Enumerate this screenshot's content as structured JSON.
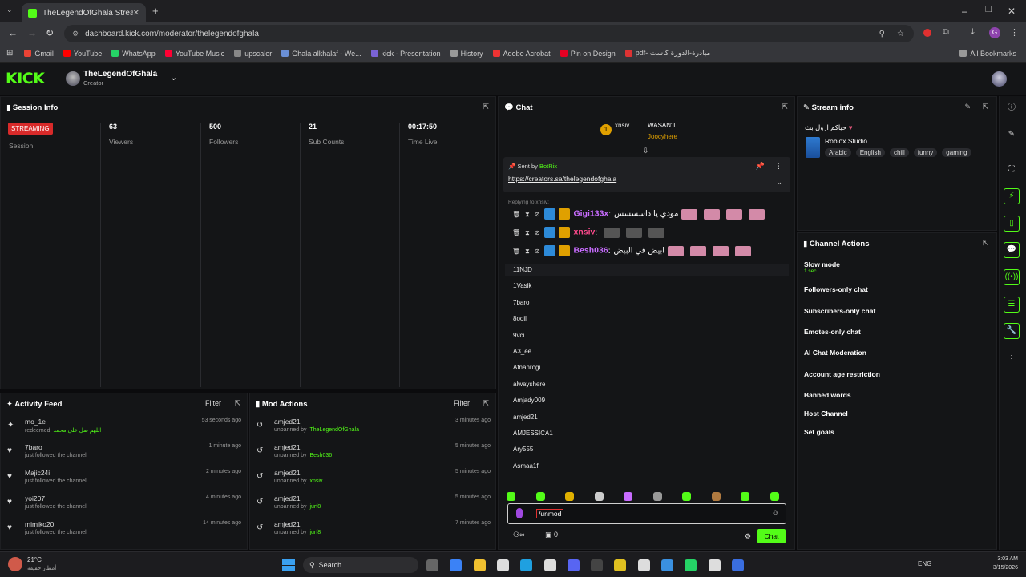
{
  "browser": {
    "tab_title": "TheLegendOfGhala Stream - Ki",
    "url": "dashboard.kick.com/moderator/thelegendofghala",
    "bookmarks": [
      "Gmail",
      "YouTube",
      "WhatsApp",
      "YouTube Music",
      "upscaler",
      "Ghala alkhalaf - We...",
      "kick - Presentation",
      "History",
      "Adobe Acrobat",
      "Pin on Design",
      "pdf- مبادرة-الدورة كاست",
      "All Bookmarks"
    ],
    "bookmark_colors": [
      "#ea4335",
      "#ff0000",
      "#25d366",
      "#ff0033",
      "#888888",
      "#6a8fd6",
      "#7a63d6",
      "#999999",
      "#e33",
      "#e60023",
      "#d33",
      "#999999"
    ]
  },
  "header": {
    "logo": "KICK",
    "channel": "TheLegendOfGhala",
    "role": "Creator"
  },
  "session": {
    "title": "Session Info",
    "status": "STREAMING",
    "status_label": "Session",
    "stats": [
      {
        "value": "63",
        "label": "Viewers"
      },
      {
        "value": "500",
        "label": "Followers"
      },
      {
        "value": "21",
        "label": "Sub Counts"
      },
      {
        "value": "00:17:50",
        "label": "Time Live"
      }
    ]
  },
  "activity": {
    "title": "Activity Feed",
    "filter": "Filter",
    "items": [
      {
        "icon": "✦",
        "name": "mo_1e",
        "sub": "redeemed",
        "sub2": "اللهم صل على محمد",
        "time": "53 seconds ago"
      },
      {
        "icon": "♥",
        "name": "7baro",
        "sub": "just followed the channel",
        "sub2": "",
        "time": "1 minute ago"
      },
      {
        "icon": "♥",
        "name": "Majic24i",
        "sub": "just followed the channel",
        "sub2": "",
        "time": "2 minutes ago"
      },
      {
        "icon": "♥",
        "name": "yoi207",
        "sub": "just followed the channel",
        "sub2": "",
        "time": "4 minutes ago"
      },
      {
        "icon": "♥",
        "name": "mimiko20",
        "sub": "just followed the channel",
        "sub2": "",
        "time": "14 minutes ago"
      }
    ]
  },
  "mod": {
    "title": "Mod Actions",
    "filter": "Filter",
    "items": [
      {
        "name": "amjed21",
        "action": "unbanned by",
        "by": "TheLegendOfGhala",
        "time": "3 minutes ago"
      },
      {
        "name": "amjed21",
        "action": "unbanned by",
        "by": "Besh036",
        "time": "5 minutes ago"
      },
      {
        "name": "amjed21",
        "action": "unbanned by",
        "by": "xnsiv",
        "time": "5 minutes ago"
      },
      {
        "name": "amjed21",
        "action": "unbanned by",
        "by": "jurf8",
        "time": "5 minutes ago"
      },
      {
        "name": "amjed21",
        "action": "unbanned by",
        "by": "jurf8",
        "time": "7 minutes ago"
      }
    ]
  },
  "chat": {
    "title": "Chat",
    "top_users": [
      "xnsiv",
      "WASAN'll",
      "Joocyhere"
    ],
    "pinned_by": "Sent by",
    "pinned_user": "BotRix",
    "pinned_link": "https://creators.sa/thelegendofghala",
    "reply": "Replying to xnsiv:",
    "messages": [
      {
        "user": "Gigi133x",
        "text": "مودي يا داسسسس",
        "color": "#c86cff"
      },
      {
        "user": "xnsiv",
        "text": "",
        "color": "#ff4a8d"
      },
      {
        "user": "Besh036",
        "text": "ابيض في البيض",
        "color": "#c86cff"
      }
    ],
    "suggestions": [
      "11NJD",
      "1Vasik",
      "7baro",
      "8ooil",
      "9vci",
      "A3_ee",
      "Afnanrogi",
      "alwayshere",
      "Amjady009",
      "amjed21",
      "AMJESSICA1",
      "Ary555",
      "Asmaa1f"
    ],
    "input": "/unmod",
    "counter": "0",
    "send": "Chat"
  },
  "stream_info": {
    "title": "Stream info",
    "stream_title": "حياكم ارول بث",
    "category": "Roblox Studio",
    "tags": [
      "Arabic",
      "English",
      "chill",
      "funny",
      "gaming"
    ]
  },
  "channel_actions": {
    "title": "Channel Actions",
    "items": [
      {
        "label": "Slow mode",
        "sub": "1 sec",
        "ctrl": "chevron"
      },
      {
        "label": "Followers-only chat",
        "sub": "",
        "ctrl": "chevron"
      },
      {
        "label": "Subscribers-only chat",
        "sub": "",
        "ctrl": "toggle"
      },
      {
        "label": "Emotes-only chat",
        "sub": "",
        "ctrl": "toggle"
      },
      {
        "label": "AI Chat Moderation",
        "sub": "",
        "ctrl": "external"
      },
      {
        "label": "Account age restriction",
        "sub": "",
        "ctrl": "chevron"
      },
      {
        "label": "Banned words",
        "sub": "",
        "ctrl": "chevron"
      },
      {
        "label": "Host Channel",
        "sub": "",
        "ctrl": "none"
      },
      {
        "label": "Set goals",
        "sub": "",
        "ctrl": "chevron"
      }
    ]
  },
  "taskbar": {
    "weather": "21°C",
    "weather_sub": "أمطار خفيفة",
    "search": "Search",
    "lang": "ENG",
    "time": "3:03 AM",
    "date": "3/15/2026"
  }
}
